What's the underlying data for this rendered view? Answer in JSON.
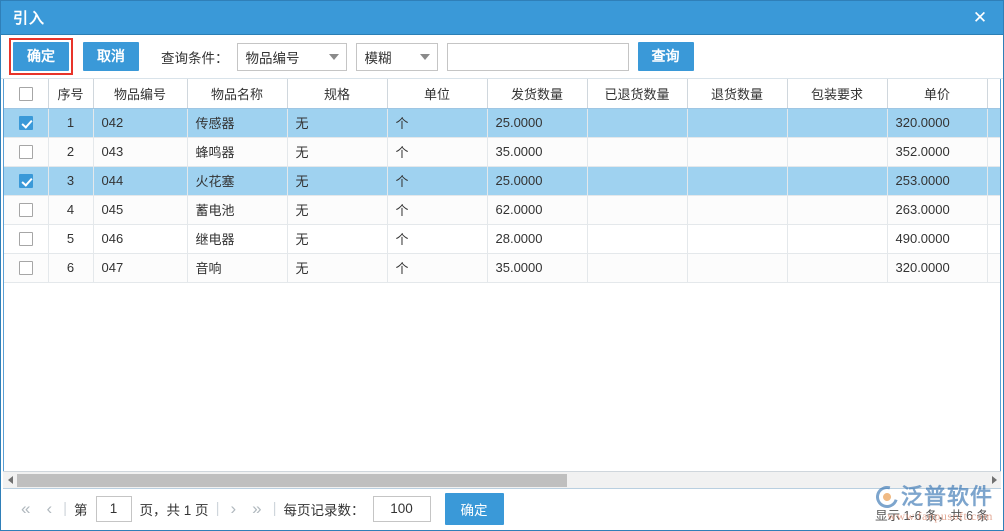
{
  "window": {
    "title": "引入",
    "close_icon": "close-icon"
  },
  "toolbar": {
    "confirm_label": "确定",
    "cancel_label": "取消",
    "condition_label": "查询条件：",
    "condition_select": "物品编号",
    "match_select": "模糊",
    "keyword_value": "",
    "keyword_placeholder": "",
    "search_label": "查询"
  },
  "grid": {
    "columns": [
      {
        "key": "check",
        "label": ""
      },
      {
        "key": "seq",
        "label": "序号"
      },
      {
        "key": "code",
        "label": "物品编号"
      },
      {
        "key": "name",
        "label": "物品名称"
      },
      {
        "key": "spec",
        "label": "规格"
      },
      {
        "key": "unit",
        "label": "单位"
      },
      {
        "key": "ship",
        "label": "发货数量"
      },
      {
        "key": "ret0",
        "label": "已退货数量"
      },
      {
        "key": "ret",
        "label": "退货数量"
      },
      {
        "key": "pack",
        "label": "包装要求"
      },
      {
        "key": "price",
        "label": "单价"
      },
      {
        "key": "tail",
        "label": ""
      }
    ],
    "header_checkbox_checked": false,
    "rows": [
      {
        "checked": true,
        "seq": "1",
        "code": "042",
        "name": "传感器",
        "spec": "无",
        "unit": "个",
        "ship": "25.0000",
        "ret0": "",
        "ret": "",
        "pack": "",
        "price": "320.0000",
        "tail": ""
      },
      {
        "checked": false,
        "seq": "2",
        "code": "043",
        "name": "蜂鸣器",
        "spec": "无",
        "unit": "个",
        "ship": "35.0000",
        "ret0": "",
        "ret": "",
        "pack": "",
        "price": "352.0000",
        "tail": ""
      },
      {
        "checked": true,
        "seq": "3",
        "code": "044",
        "name": "火花塞",
        "spec": "无",
        "unit": "个",
        "ship": "25.0000",
        "ret0": "",
        "ret": "",
        "pack": "",
        "price": "253.0000",
        "tail": ""
      },
      {
        "checked": false,
        "seq": "4",
        "code": "045",
        "name": "蓄电池",
        "spec": "无",
        "unit": "个",
        "ship": "62.0000",
        "ret0": "",
        "ret": "",
        "pack": "",
        "price": "263.0000",
        "tail": ""
      },
      {
        "checked": false,
        "seq": "5",
        "code": "046",
        "name": "继电器",
        "spec": "无",
        "unit": "个",
        "ship": "28.0000",
        "ret0": "",
        "ret": "",
        "pack": "",
        "price": "490.0000",
        "tail": ""
      },
      {
        "checked": false,
        "seq": "6",
        "code": "047",
        "name": "音响",
        "spec": "无",
        "unit": "个",
        "ship": "35.0000",
        "ret0": "",
        "ret": "",
        "pack": "",
        "price": "320.0000",
        "tail": ""
      }
    ]
  },
  "footer": {
    "first_label": "«",
    "prev_label": "‹",
    "page_prefix": "第",
    "page_value": "1",
    "page_suffix": "页，共 1 页",
    "next_label": "›",
    "last_label": "»",
    "pagesize_label": "每页记录数：",
    "pagesize_value": "100",
    "confirm_label": "确定",
    "status": "显示 1-6 条，共 6 条"
  },
  "watermark": {
    "brand": "泛普软件",
    "url": "www.fanpusoft.com"
  },
  "colors": {
    "accent": "#3a99d8",
    "selected_row": "#9fd2f0",
    "highlight_border": "#e8342a"
  }
}
